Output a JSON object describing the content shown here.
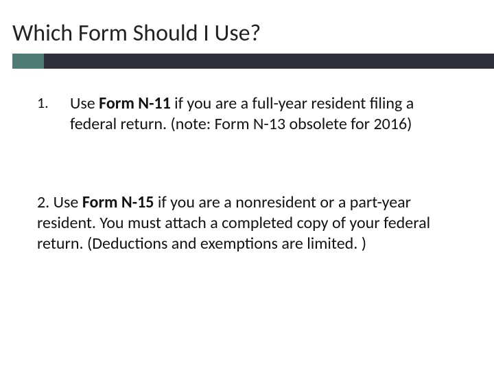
{
  "title": "Which Form Should I Use?",
  "accent_color": "#4E7B74",
  "bar_color": "#2F2F3A",
  "items": {
    "one": {
      "num": "1.",
      "pre": "Use ",
      "bold": "Form N-11",
      "post": " if you are a full-year resident filing a federal return. (note: Form N-13 obsolete for 2016)"
    },
    "two": {
      "pre": "2.   Use ",
      "bold": "Form N-15",
      "post": " if you are a nonresident or a part-year resident. You must attach a completed copy of your federal return. (Deductions and exemptions are limited. )"
    }
  }
}
